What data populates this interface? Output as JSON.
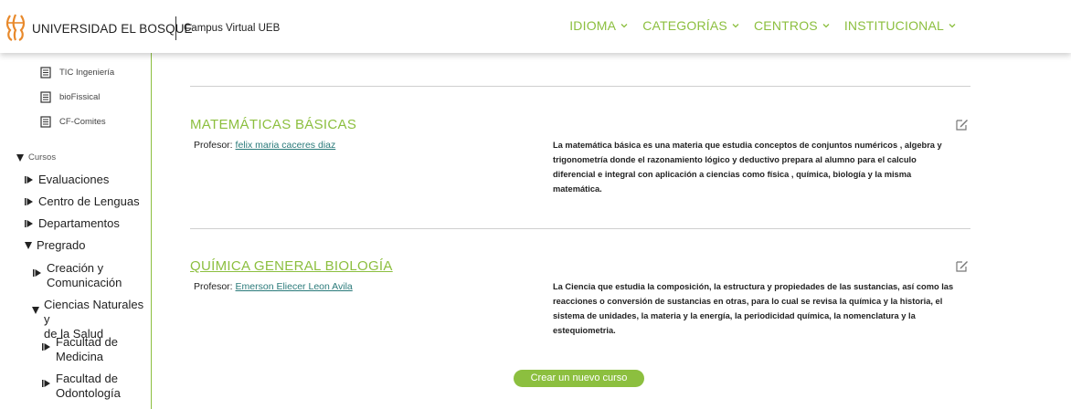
{
  "header": {
    "brand": "UNIVERSIDAD EL BOSQUE",
    "subtitle": "Campus Virtual UEB",
    "nav": [
      "IDIOMA",
      "CATEGORÍAS",
      "CENTROS",
      "INSTITUCIONAL"
    ]
  },
  "sidebar": {
    "docs": [
      "TIC Ingeniería",
      "bioFissical",
      "CF-Comites"
    ],
    "cursos_label": "Cursos",
    "items": [
      {
        "label": "Evaluaciones"
      },
      {
        "label": "Centro de Lenguas"
      },
      {
        "label": "Departamentos"
      },
      {
        "label": "Pregrado"
      },
      {
        "label1": "Creación y",
        "label2": "Comunicación"
      },
      {
        "label1": "Ciencias Naturales y",
        "label2": "de la Salud"
      },
      {
        "label1": "Facultad de",
        "label2": "Medicina"
      },
      {
        "label1": "Facultad de",
        "label2": "Odontología"
      }
    ]
  },
  "courses": [
    {
      "title": "MATEMÁTICAS BÁSICAS",
      "prof_label": "Profesor:",
      "prof_name": "felix maria caceres diaz",
      "desc_lines": [
        "La matemática básica es una materia que estudia conceptos de conjuntos numéricos , algebra y",
        "trigonometría donde el razonamiento lógico y deductivo prepara al alumno para el calculo",
        "diferencial e integral con aplicación a ciencias como física , química, biología y la misma",
        "matemática."
      ]
    },
    {
      "title": "QUÍMICA GENERAL BIOLOGÍA",
      "prof_label": "Profesor:",
      "prof_name": "Emerson Eliecer Leon Avila",
      "desc_lines": [
        "La Ciencia que estudia la composición, la estructura y propiedades de las sustancias, así como las",
        "reacciones o conversión de sustancias en otras, para lo cual se revisa la química y la historia, el",
        "sistema de unidades, la materia y la energía, la periodicidad química, la nomenclatura y la",
        "estequiometria."
      ]
    }
  ],
  "new_course_button": "Crear un nuevo curso",
  "colors": {
    "accent": "#8cbf3f",
    "link": "#2a7a7a",
    "logo": "#e8892b"
  }
}
